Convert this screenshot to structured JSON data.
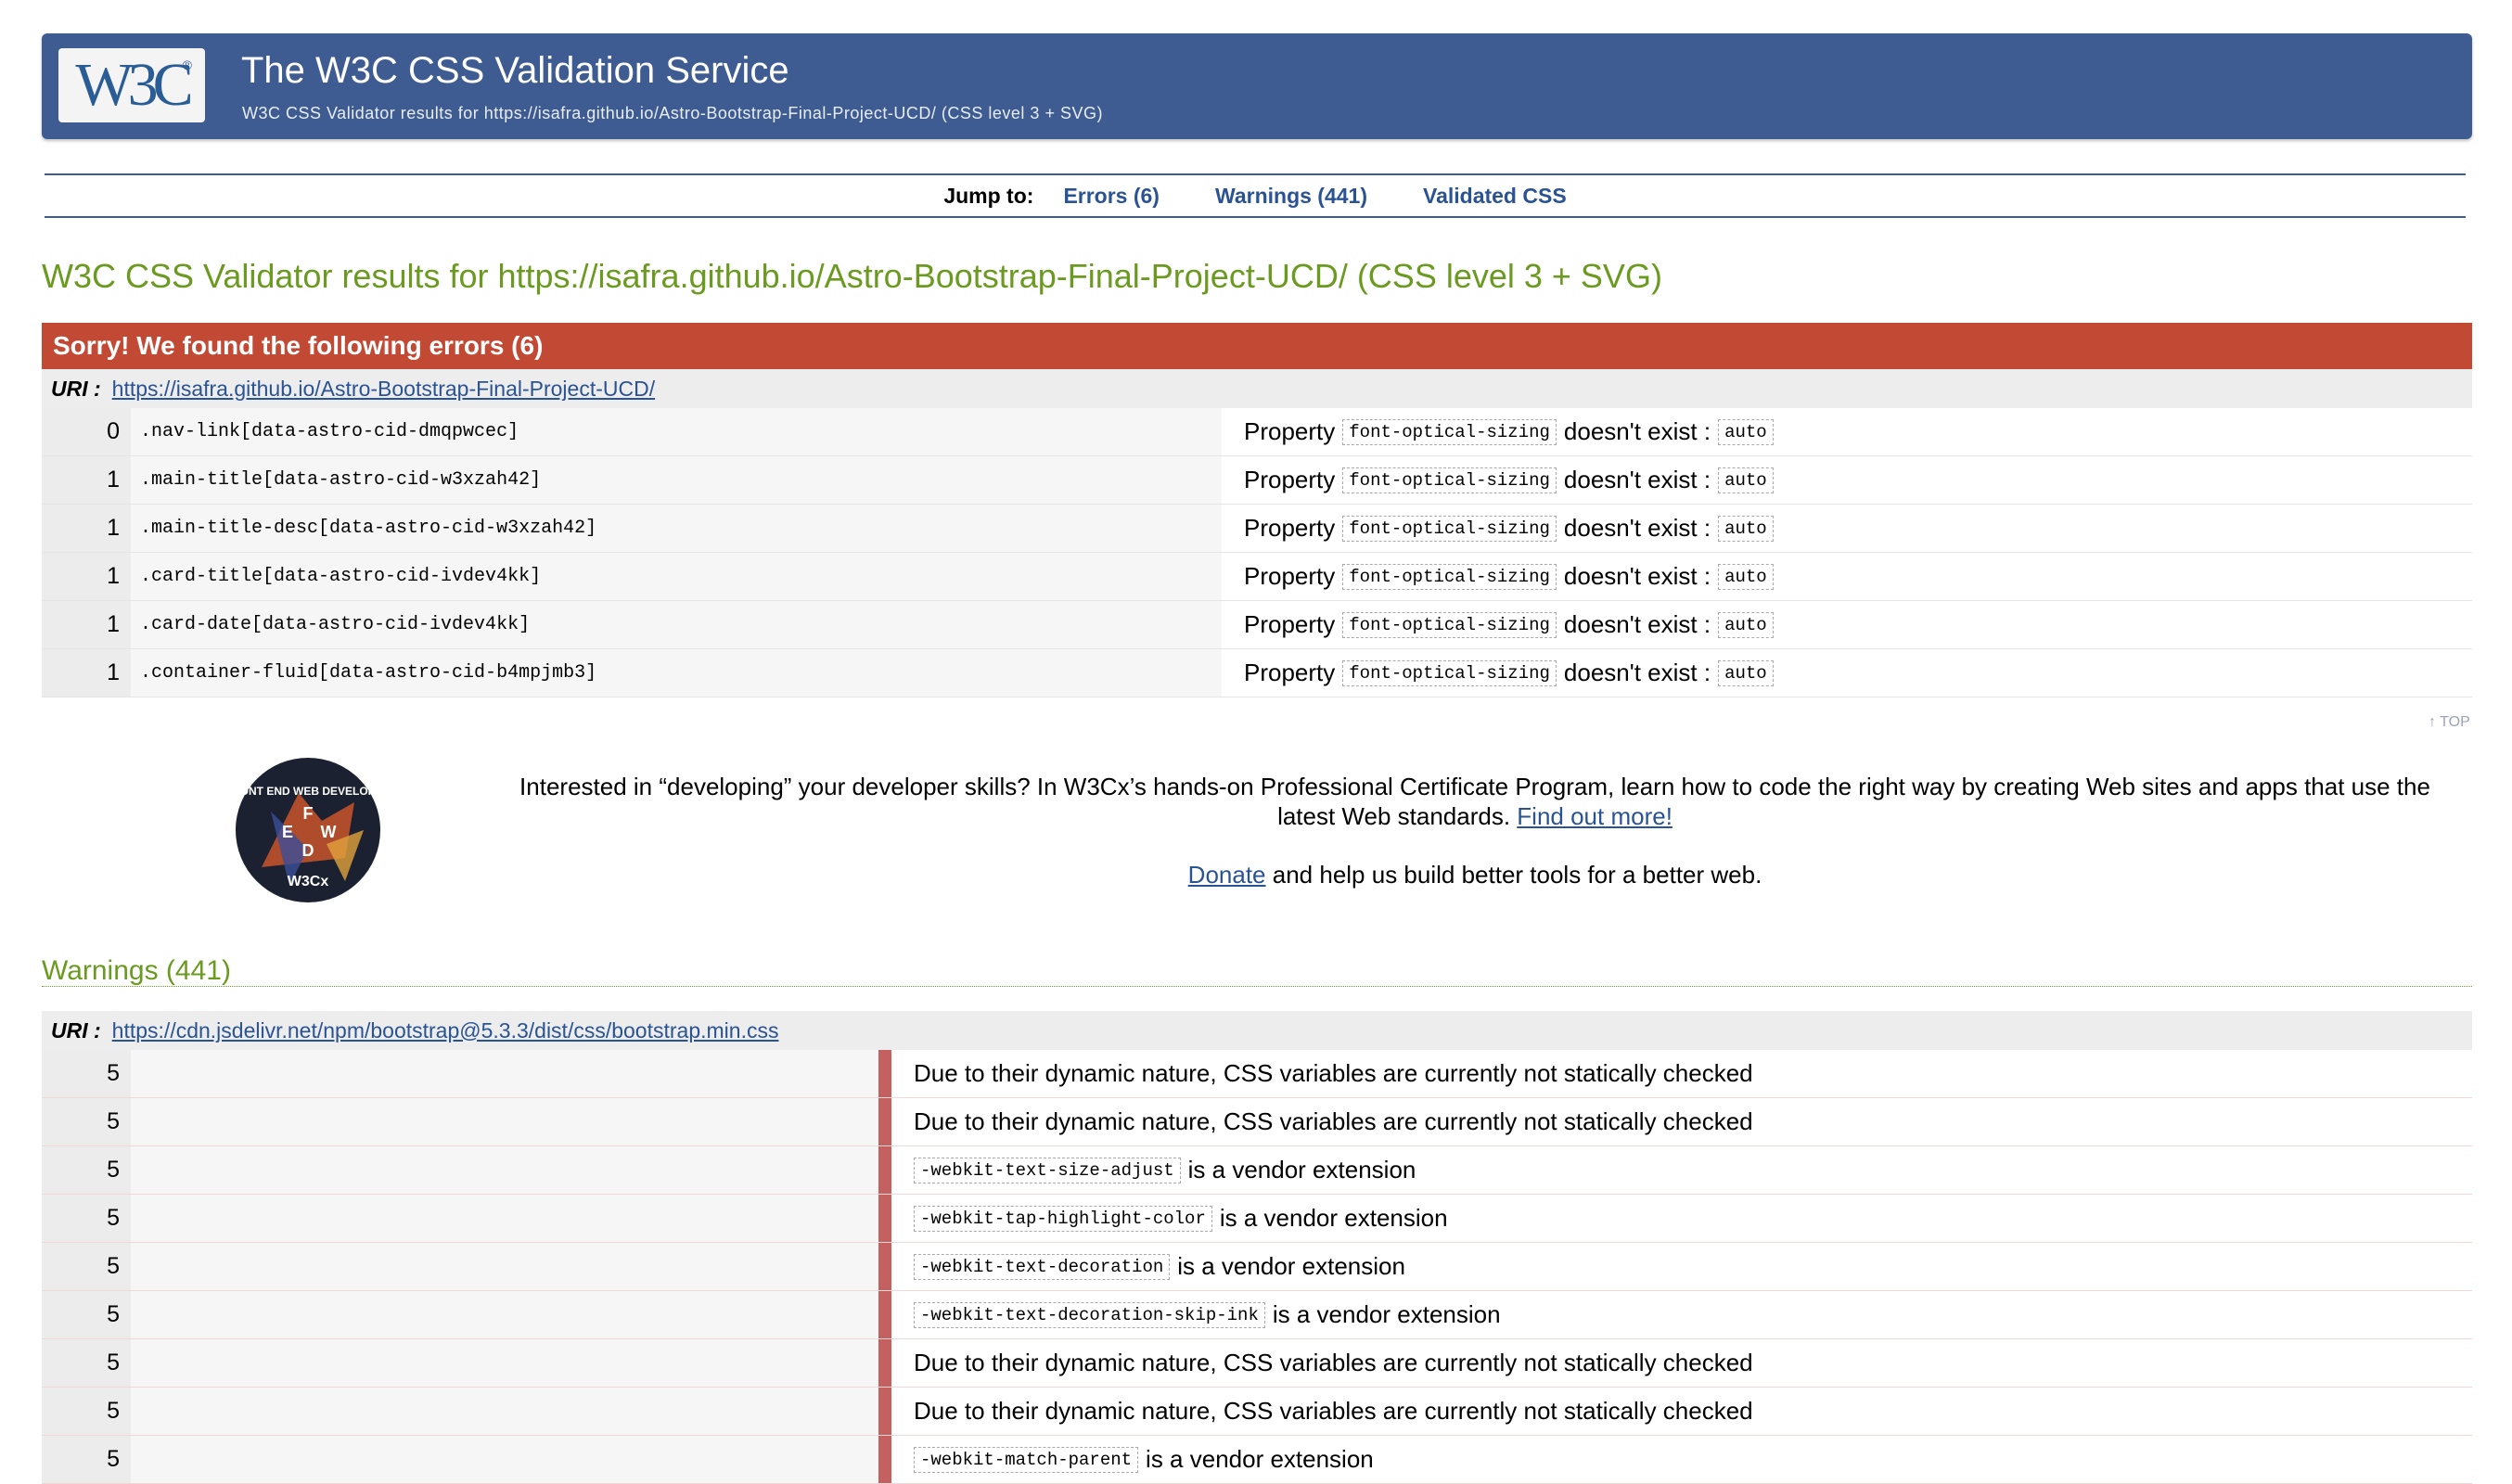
{
  "header": {
    "logo_text": "W3C",
    "logo_reg": "®",
    "title": "The W3C CSS Validation Service",
    "subtitle": "W3C CSS Validator results for https://isafra.github.io/Astro-Bootstrap-Final-Project-UCD/ (CSS level 3 + SVG)"
  },
  "jump": {
    "label": "Jump to:",
    "errors": "Errors (6)",
    "warnings": "Warnings (441)",
    "validated": "Validated CSS"
  },
  "results_title": "W3C CSS Validator results for https://isafra.github.io/Astro-Bootstrap-Final-Project-UCD/ (CSS level 3 + SVG)",
  "errors": {
    "heading": "Sorry! We found the following errors (6)",
    "uri_label": "URI :",
    "uri": "https://isafra.github.io/Astro-Bootstrap-Final-Project-UCD/",
    "rows": [
      {
        "line": "0",
        "context": ".nav-link[data-astro-cid-dmqpwcec]",
        "pre": "Property",
        "prop": "font-optical-sizing",
        "mid": "doesn't exist :",
        "val": "auto"
      },
      {
        "line": "1",
        "context": ".main-title[data-astro-cid-w3xzah42]",
        "pre": "Property",
        "prop": "font-optical-sizing",
        "mid": "doesn't exist :",
        "val": "auto"
      },
      {
        "line": "1",
        "context": ".main-title-desc[data-astro-cid-w3xzah42]",
        "pre": "Property",
        "prop": "font-optical-sizing",
        "mid": "doesn't exist :",
        "val": "auto"
      },
      {
        "line": "1",
        "context": ".card-title[data-astro-cid-ivdev4kk]",
        "pre": "Property",
        "prop": "font-optical-sizing",
        "mid": "doesn't exist :",
        "val": "auto"
      },
      {
        "line": "1",
        "context": ".card-date[data-astro-cid-ivdev4kk]",
        "pre": "Property",
        "prop": "font-optical-sizing",
        "mid": "doesn't exist :",
        "val": "auto"
      },
      {
        "line": "1",
        "context": ".container-fluid[data-astro-cid-b4mpjmb3]",
        "pre": "Property",
        "prop": "font-optical-sizing",
        "mid": "doesn't exist :",
        "val": "auto"
      }
    ]
  },
  "top_link": "↑ TOP",
  "promo": {
    "text": "Interested in “developing” your developer skills? In W3Cx’s hands-on Professional Certificate Program, learn how to code the right way by creating Web sites and apps that use the latest Web standards.",
    "find_out": "Find out more!",
    "donate": "Donate",
    "donate_rest": "and help us build better tools for a better web.",
    "badge_text": "W3Cx",
    "badge_ring": "FRONT END WEB DEVELOPER",
    "badge_letters": [
      "F",
      "E",
      "W",
      "D"
    ]
  },
  "warnings": {
    "title": "Warnings (441)",
    "uri_label": "URI :",
    "uri": "https://cdn.jsdelivr.net/npm/bootstrap@5.3.3/dist/css/bootstrap.min.css",
    "rows": [
      {
        "line": "5",
        "text": "Due to their dynamic nature, CSS variables are currently not statically checked",
        "code": ""
      },
      {
        "line": "5",
        "text": "Due to their dynamic nature, CSS variables are currently not statically checked",
        "code": ""
      },
      {
        "line": "5",
        "code": "-webkit-text-size-adjust",
        "text": "is a vendor extension"
      },
      {
        "line": "5",
        "code": "-webkit-tap-highlight-color",
        "text": "is a vendor extension"
      },
      {
        "line": "5",
        "code": "-webkit-text-decoration",
        "text": "is a vendor extension"
      },
      {
        "line": "5",
        "code": "-webkit-text-decoration-skip-ink",
        "text": "is a vendor extension"
      },
      {
        "line": "5",
        "text": "Due to their dynamic nature, CSS variables are currently not statically checked",
        "code": ""
      },
      {
        "line": "5",
        "text": "Due to their dynamic nature, CSS variables are currently not statically checked",
        "code": ""
      },
      {
        "line": "5",
        "code": "-webkit-match-parent",
        "text": "is a vendor extension"
      }
    ]
  },
  "colors": {
    "banner": "#3e5b92",
    "error_header": "#c24934",
    "title_green": "#6a9a1f",
    "link": "#2a5394",
    "warning_bar": "#c46060"
  }
}
